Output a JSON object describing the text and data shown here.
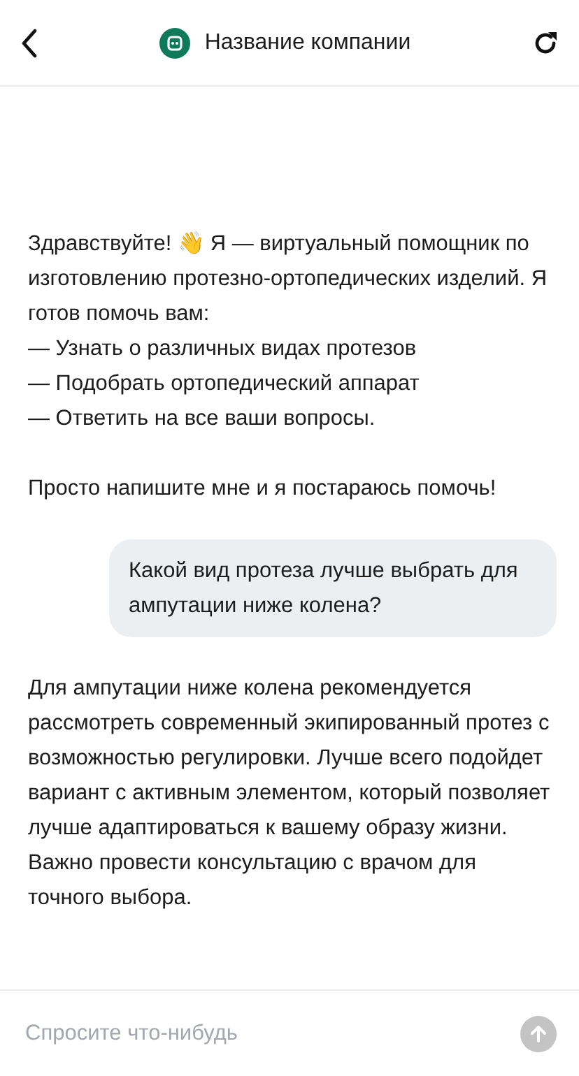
{
  "header": {
    "title": "Название компании"
  },
  "messages": [
    {
      "kind": "bot",
      "paragraphs": [
        "Здравствуйте! 👋 Я — виртуальный помощник по изготовлению протезно-ортопедических изделий. Я готов помочь вам:\n— Узнать о различных видах протезов\n— Подобрать ортопедический аппарат\n— Ответить на все ваши вопросы.",
        "Просто напишите мне и я постараюсь помочь!"
      ]
    },
    {
      "kind": "user",
      "paragraphs": [
        "Какой вид протеза лучше выбрать для ампутации ниже колена?"
      ]
    },
    {
      "kind": "bot",
      "paragraphs": [
        "Для ампутации ниже колена рекомендуется рассмотреть современный экипированный протез с возможностью регулировки. Лучше всего подойдет вариант с активным элементом, который позволяет лучше адаптироваться к вашему образу жизни. Важно провести консультацию с врачом для точного выбора."
      ]
    }
  ],
  "composer": {
    "placeholder": "Спросите что-нибудь",
    "send_disabled": true
  }
}
